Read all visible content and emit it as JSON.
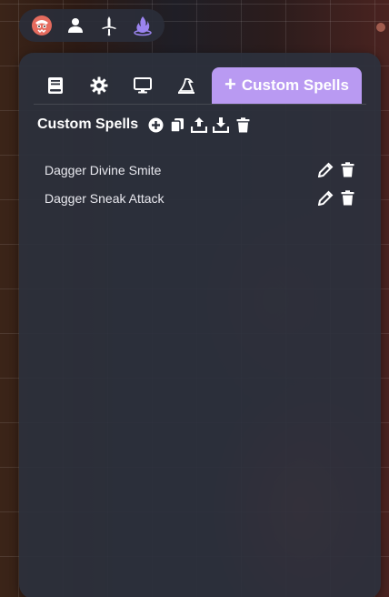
{
  "mode_bar": {
    "items": [
      {
        "icon": "monster-face-icon"
      },
      {
        "icon": "person-icon"
      },
      {
        "icon": "sword-icon"
      },
      {
        "icon": "magic-fire-icon"
      }
    ]
  },
  "tabs": [
    {
      "icon": "book-icon"
    },
    {
      "icon": "gear-icon"
    },
    {
      "icon": "monitor-icon"
    },
    {
      "icon": "wizard-hat-icon"
    },
    {
      "icon": "plus-icon",
      "label": "Custom Spells",
      "active": true
    }
  ],
  "section": {
    "title": "Custom Spells"
  },
  "spells": [
    {
      "name": "Dagger Divine Smite"
    },
    {
      "name": "Dagger Sneak Attack"
    }
  ],
  "colors": {
    "accent": "#b99af2",
    "panel": "#2c303c"
  }
}
